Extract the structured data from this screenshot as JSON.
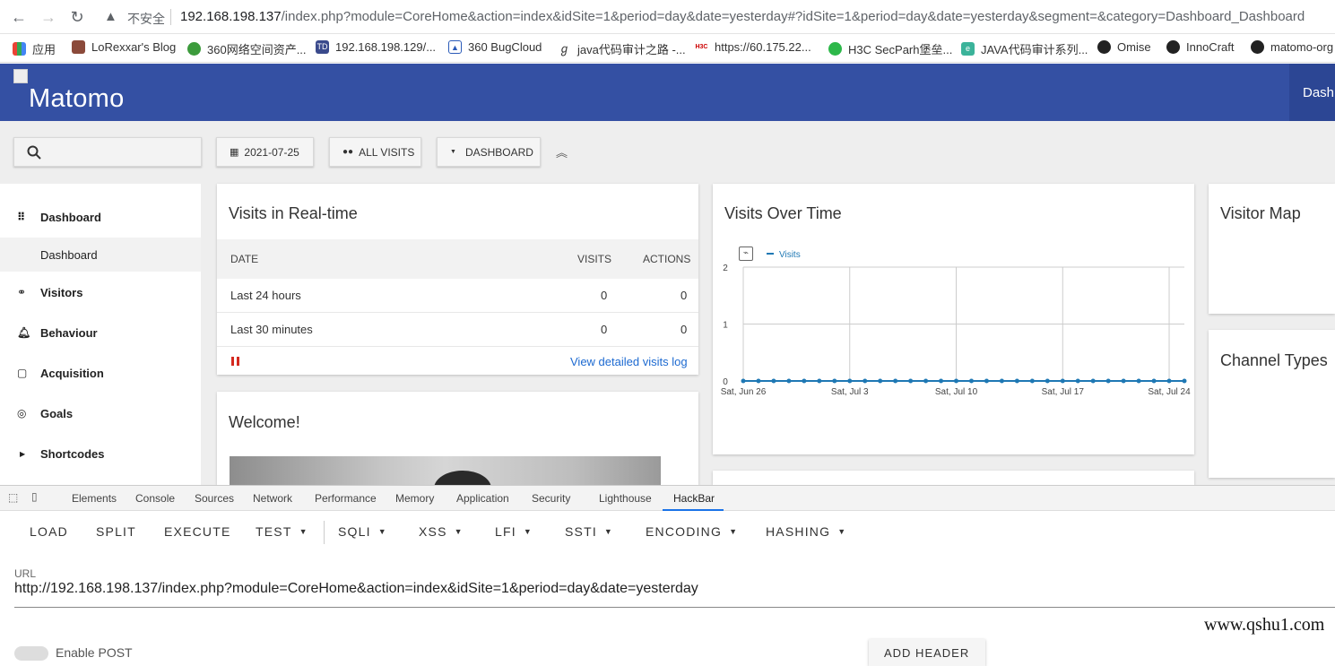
{
  "browser": {
    "insecure_label": "不安全",
    "url_host": "192.168.198.137",
    "url_rest": "/index.php?module=CoreHome&action=index&idSite=1&period=day&date=yesterday#?idSite=1&period=day&date=yesterday&segment=&category=Dashboard_Dashboard",
    "bookmarks": [
      "应用",
      "LoRexxar's Blog",
      "360网络空间资产...",
      "192.168.198.129/...",
      "360 BugCloud",
      "java代码审计之路 -...",
      "https://60.175.22...",
      "H3C SecParh堡垒...",
      "JAVA代码审计系列...",
      "Omise",
      "InnoCraft",
      "matomo-org"
    ]
  },
  "matomo": {
    "logo_text": "Matomo",
    "top_tab": "Dashboard",
    "toolbar": {
      "date": "2021-07-25",
      "segment": "ALL VISITS",
      "dashboard": "DASHBOARD"
    },
    "sidebar": {
      "dashboard": "Dashboard",
      "dashboard_sub": "Dashboard",
      "visitors": "Visitors",
      "behaviour": "Behaviour",
      "acquisition": "Acquisition",
      "goals": "Goals",
      "shortcodes": "Shortcodes"
    },
    "realtime": {
      "title": "Visits in Real-time",
      "col_date": "DATE",
      "col_visits": "VISITS",
      "col_actions": "ACTIONS",
      "rows": [
        {
          "date": "Last 24 hours",
          "visits": "0",
          "actions": "0"
        },
        {
          "date": "Last 30 minutes",
          "visits": "0",
          "actions": "0"
        }
      ],
      "link": "View detailed visits log"
    },
    "welcome_title": "Welcome!",
    "visits_over_time_title": "Visits Over Time",
    "visitor_map_title": "Visitor Map",
    "channel_types_title": "Channel Types"
  },
  "chart_data": {
    "type": "line",
    "series": [
      {
        "name": "Visits",
        "values": [
          0,
          0,
          0,
          0,
          0,
          0,
          0,
          0,
          0,
          0,
          0,
          0,
          0,
          0,
          0,
          0,
          0,
          0,
          0,
          0,
          0,
          0,
          0,
          0,
          0,
          0,
          0,
          0,
          0,
          0
        ]
      }
    ],
    "x_tick_labels": [
      "Sat, Jun 26",
      "Sat, Jul 3",
      "Sat, Jul 10",
      "Sat, Jul 17",
      "Sat, Jul 24"
    ],
    "ylim": [
      0,
      2
    ],
    "y_ticks": [
      "0",
      "1",
      "2"
    ],
    "grid": true,
    "legend": "top-left",
    "color": "#1f78b4"
  },
  "devtools": {
    "tabs": [
      "Elements",
      "Console",
      "Sources",
      "Network",
      "Performance",
      "Memory",
      "Application",
      "Security",
      "Lighthouse",
      "HackBar"
    ],
    "active_tab": "HackBar"
  },
  "hackbar": {
    "buttons": [
      "LOAD",
      "SPLIT",
      "EXECUTE",
      "TEST",
      "SQLI",
      "XSS",
      "LFI",
      "SSTI",
      "ENCODING",
      "HASHING"
    ],
    "url_label": "URL",
    "url_value": "http://192.168.198.137/index.php?module=CoreHome&action=index&idSite=1&period=day&date=yesterday",
    "enable_post": "Enable POST",
    "add_header": "ADD HEADER"
  },
  "watermark": "www.qshu1.com"
}
